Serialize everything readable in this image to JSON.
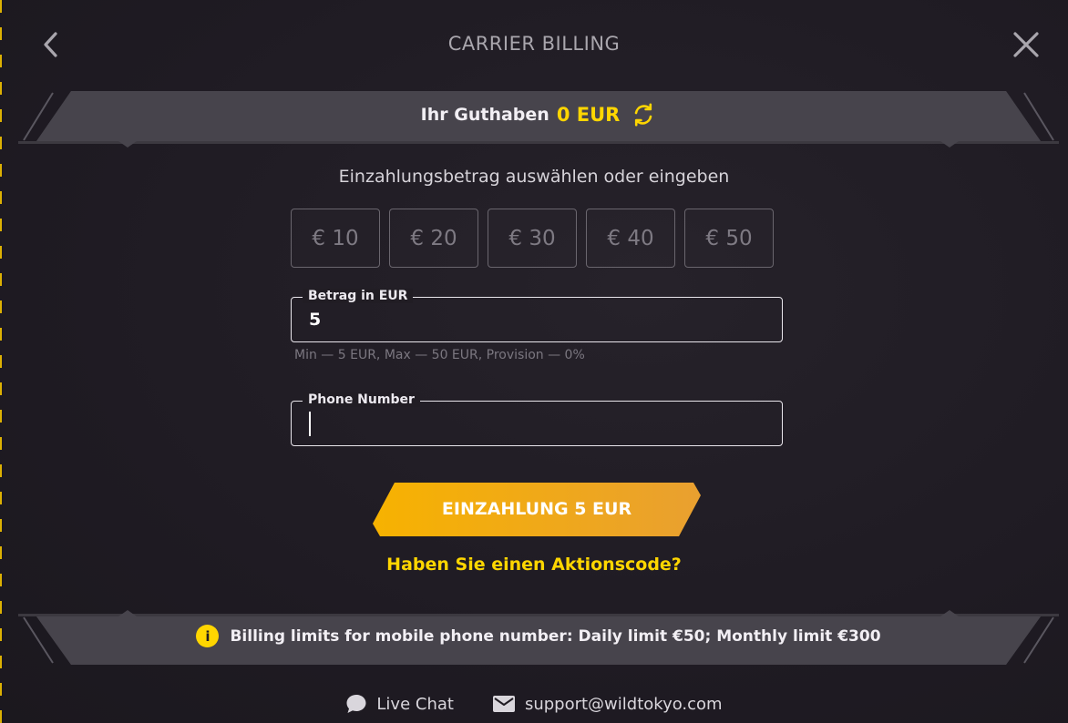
{
  "header": {
    "title": "CARRIER BILLING",
    "back_icon": "chevron-left-icon",
    "close_icon": "close-icon"
  },
  "balance": {
    "label": "Ihr Guthaben",
    "amount": "0 EUR",
    "refresh_icon": "refresh-icon"
  },
  "deposit": {
    "prompt": "Einzahlungsbetrag auswählen oder eingeben",
    "amounts": [
      "€ 10",
      "€ 20",
      "€ 30",
      "€ 40",
      "€ 50"
    ],
    "amount_field": {
      "label": "Betrag in EUR",
      "value": "5"
    },
    "hint": "Min — 5 EUR, Max — 50 EUR, Provision — 0%",
    "phone_field": {
      "label": "Phone Number",
      "value": ""
    },
    "submit_label": "EINZAHLUNG 5 EUR",
    "promo_link": "Haben Sie einen Aktionscode?"
  },
  "limits": {
    "icon": "info-icon",
    "text": "Billing limits for mobile phone number: Daily limit €50; Monthly limit €300"
  },
  "contacts": {
    "live_chat": "Live Chat",
    "email": "support@wildtokyo.com"
  },
  "colors": {
    "background": "#1f1b22",
    "accent_yellow": "#ffd600",
    "button_orange": "#f2a818",
    "muted_text": "#7b7780"
  }
}
